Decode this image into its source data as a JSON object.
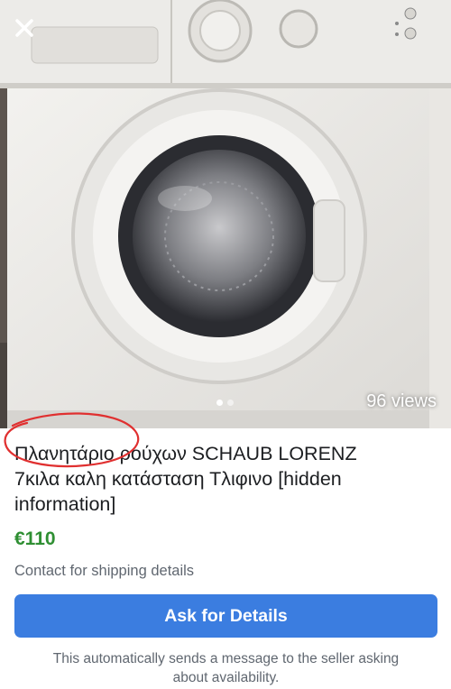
{
  "photo": {
    "close_icon": "close-icon",
    "views": "96 views",
    "carousel": {
      "count": 2,
      "active": 0
    }
  },
  "listing": {
    "title_lines": [
      "Πλανητάριο ρούχων SCHAUB LORENZ",
      "7κιλα  καλη κατάσταση  Τλιφινο [hidden",
      "information]"
    ],
    "price": "€110",
    "shipping": "Contact for shipping details"
  },
  "cta": {
    "button_label": "Ask for Details",
    "note_lines": [
      "This automatically sends a message to the seller asking",
      "about availability."
    ]
  },
  "colors": {
    "button": "#3b7de0",
    "price": "#2f8f33",
    "annotation": "#e03030"
  }
}
